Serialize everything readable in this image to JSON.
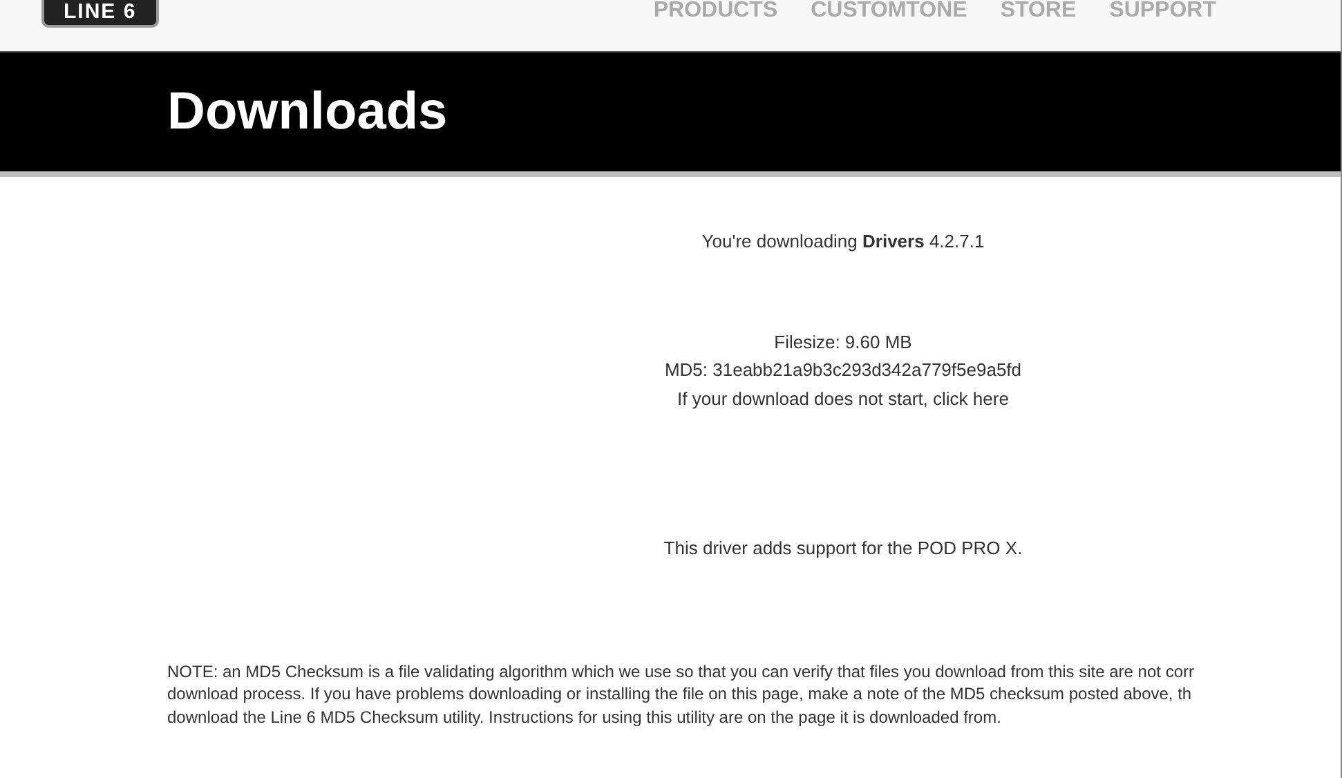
{
  "header": {
    "logo": "LINE 6",
    "nav": [
      {
        "label": "PRODUCTS"
      },
      {
        "label": "CUSTOMTONE"
      },
      {
        "label": "STORE"
      },
      {
        "label": "SUPPORT"
      }
    ]
  },
  "banner": {
    "title": "Downloads"
  },
  "download": {
    "intro": "You're downloading **Drivers** 4.2.7.1",
    "filesize": "Filesize: 9.60 MB",
    "md5": "MD5: 31eabb21a9b3c293d342a779f5e9a5fd",
    "fallback_prefix": "If your download does not start, ",
    "fallback_link": "click here",
    "description": "This driver adds support for the POD PRO X."
  },
  "note": [
    "NOTE: an MD5 Checksum is a file validating algorithm which we use so that you can verify that files you download from this site are not corr",
    "download process. If you have problems downloading or installing the file on this page, make a note of the MD5 checksum posted above, th",
    "download the Line 6 MD5 Checksum utility. Instructions for using this utility are on the page it is downloaded from."
  ]
}
